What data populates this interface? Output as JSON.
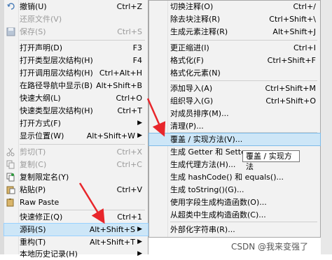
{
  "main_menu": {
    "items": [
      {
        "label": "撤销(U)",
        "accel": "Ctrl+Z",
        "disabled": false,
        "icon": "undo-icon"
      },
      {
        "label": "还原文件(V)",
        "accel": "",
        "disabled": true
      },
      {
        "label": "保存(S)",
        "accel": "Ctrl+S",
        "disabled": true,
        "icon": "save-icon"
      },
      {
        "label": "打开声明(D)",
        "accel": "F3"
      },
      {
        "label": "打开类型层次结构(H)",
        "accel": "F4"
      },
      {
        "label": "打开调用层次结构(H)",
        "accel": "Ctrl+Alt+H"
      },
      {
        "label": "在路径导航中显示(B)",
        "accel": "Alt+Shift+B"
      },
      {
        "label": "快速大纲(L)",
        "accel": "Ctrl+O"
      },
      {
        "label": "快速类型层次结构(H)",
        "accel": "Ctrl+T"
      },
      {
        "label": "打开方式(F)",
        "accel": ""
      },
      {
        "label": "显示位置(W)",
        "accel": "Alt+Shift+W"
      },
      {
        "label": "剪切(T)",
        "accel": "Ctrl+X",
        "disabled": true,
        "icon": "cut-icon"
      },
      {
        "label": "复制(C)",
        "accel": "Ctrl+C",
        "disabled": true,
        "icon": "copy-icon"
      },
      {
        "label": "复制限定名(Y)",
        "accel": "",
        "icon": "copy-qualified-icon"
      },
      {
        "label": "粘贴(P)",
        "accel": "Ctrl+V",
        "icon": "paste-icon"
      },
      {
        "label": "Raw Paste",
        "accel": "",
        "icon": "raw-paste-icon"
      },
      {
        "label": "快速修正(Q)",
        "accel": "Ctrl+1"
      },
      {
        "label": "源码(S)",
        "accel": "Alt+Shift+S"
      },
      {
        "label": "重构(T)",
        "accel": "Alt+Shift+T"
      },
      {
        "label": "本地历史记录(H)",
        "accel": ""
      }
    ]
  },
  "sub_menu": {
    "items": [
      {
        "label": "切换注释(O)",
        "accel": "Ctrl+/"
      },
      {
        "label": "除去块注释(R)",
        "accel": "Ctrl+Shift+\\"
      },
      {
        "label": "生成元素注释(R)",
        "accel": "Alt+Shift+J"
      },
      {
        "label": "更正缩进(I)",
        "accel": "Ctrl+I"
      },
      {
        "label": "格式化(F)",
        "accel": "Ctrl+Shift+F"
      },
      {
        "label": "格式化元素(N)",
        "accel": ""
      },
      {
        "label": "添加导入(A)",
        "accel": "Ctrl+Shift+M"
      },
      {
        "label": "组织导入(G)",
        "accel": "Ctrl+Shift+O"
      },
      {
        "label": "对成员排序(M)...",
        "accel": ""
      },
      {
        "label": "清理(P)...",
        "accel": ""
      },
      {
        "label": "覆盖 / 实现方法(V)...",
        "accel": ""
      },
      {
        "label": "生成 Getter 和 Setter...",
        "accel": ""
      },
      {
        "label": "生成代理方法(H)...",
        "accel": ""
      },
      {
        "label": "生成 hashCode() 和 equals()...",
        "accel": ""
      },
      {
        "label": "生成 toString()(G)...",
        "accel": ""
      },
      {
        "label": "使用字段生成构造函数(O)...",
        "accel": ""
      },
      {
        "label": "从超类中生成构造函数(C)...",
        "accel": ""
      },
      {
        "label": "外部化字符串(R)...",
        "accel": ""
      }
    ]
  },
  "tooltip": {
    "text": "覆盖 / 实现方法"
  },
  "watermark": {
    "text": "CSDN @我来变强了"
  },
  "colors": {
    "highlight": "#cde6f7",
    "arrow": "#e8262b",
    "disabled_text": "#9a9a9a"
  }
}
